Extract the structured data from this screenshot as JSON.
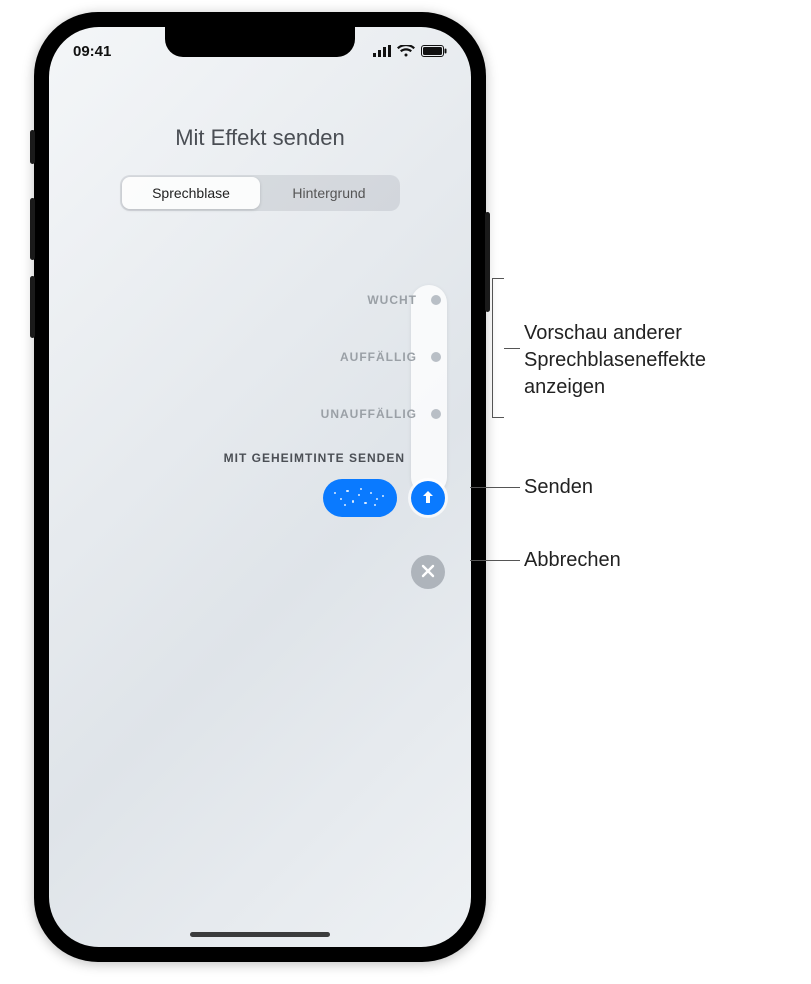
{
  "status": {
    "time": "09:41"
  },
  "header": {
    "title": "Mit Effekt senden"
  },
  "segmented": {
    "bubble": "Sprechblase",
    "background": "Hintergrund"
  },
  "effects": {
    "row0": "WUCHT",
    "row1": "AUFFÄLLIG",
    "row2": "UNAUFFÄLLIG",
    "row3": "MIT GEHEIMTINTE SENDEN"
  },
  "callouts": {
    "preview": "Vorschau anderer\nSprechblaseneffekte\nanzeigen",
    "send": "Senden",
    "cancel": "Abbrechen"
  }
}
